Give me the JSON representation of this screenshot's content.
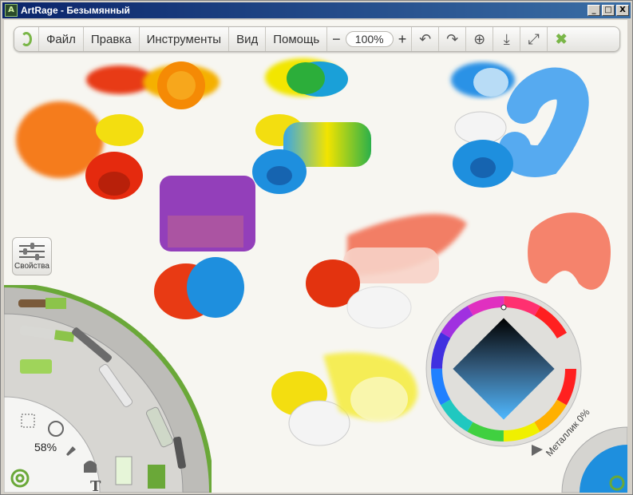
{
  "window": {
    "title": "ArtRage - Безымянный",
    "icon_label": "A",
    "buttons": {
      "minimize": "_",
      "maximize": "□",
      "close": "X"
    }
  },
  "toolbar": {
    "menus": [
      "Файл",
      "Правка",
      "Инструменты",
      "Вид",
      "Помощь"
    ],
    "zoom_minus": "−",
    "zoom_value": "100%",
    "zoom_plus": "+",
    "icons": [
      "undo-icon",
      "redo-icon",
      "add-icon",
      "save-icon",
      "fullscreen-icon",
      "close-icon"
    ]
  },
  "properties_panel": {
    "label": "Свойства"
  },
  "tool_picker": {
    "brush_size": "58%"
  },
  "color_picker": {
    "metallic_label": "Металлик 0%",
    "current_color": "#1e8fde"
  },
  "colors": {
    "accent_green": "#7ab648",
    "title_bar": "#0a246a",
    "canvas": "#f7f6f1"
  }
}
